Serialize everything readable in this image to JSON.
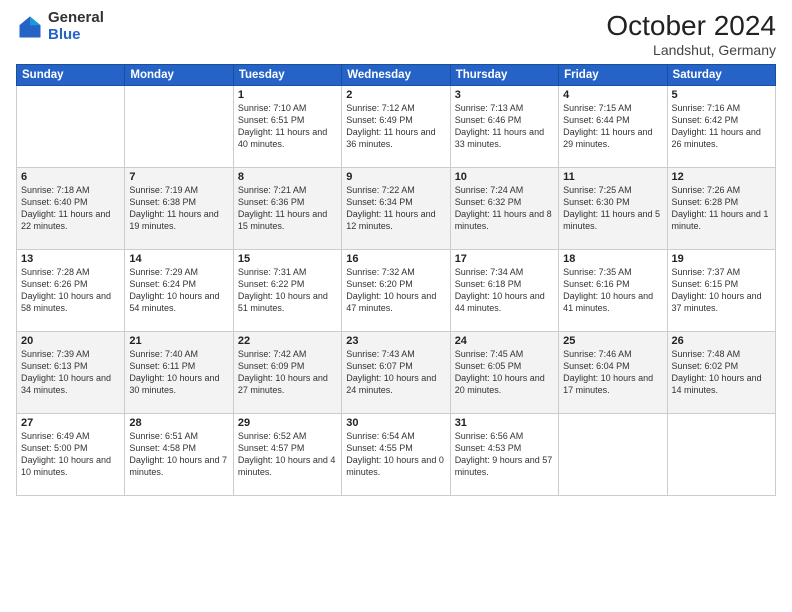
{
  "header": {
    "logo_general": "General",
    "logo_blue": "Blue",
    "month_title": "October 2024",
    "location": "Landshut, Germany"
  },
  "weekdays": [
    "Sunday",
    "Monday",
    "Tuesday",
    "Wednesday",
    "Thursday",
    "Friday",
    "Saturday"
  ],
  "weeks": [
    [
      {
        "day": "",
        "sunrise": "",
        "sunset": "",
        "daylight": ""
      },
      {
        "day": "",
        "sunrise": "",
        "sunset": "",
        "daylight": ""
      },
      {
        "day": "1",
        "sunrise": "Sunrise: 7:10 AM",
        "sunset": "Sunset: 6:51 PM",
        "daylight": "Daylight: 11 hours and 40 minutes."
      },
      {
        "day": "2",
        "sunrise": "Sunrise: 7:12 AM",
        "sunset": "Sunset: 6:49 PM",
        "daylight": "Daylight: 11 hours and 36 minutes."
      },
      {
        "day": "3",
        "sunrise": "Sunrise: 7:13 AM",
        "sunset": "Sunset: 6:46 PM",
        "daylight": "Daylight: 11 hours and 33 minutes."
      },
      {
        "day": "4",
        "sunrise": "Sunrise: 7:15 AM",
        "sunset": "Sunset: 6:44 PM",
        "daylight": "Daylight: 11 hours and 29 minutes."
      },
      {
        "day": "5",
        "sunrise": "Sunrise: 7:16 AM",
        "sunset": "Sunset: 6:42 PM",
        "daylight": "Daylight: 11 hours and 26 minutes."
      }
    ],
    [
      {
        "day": "6",
        "sunrise": "Sunrise: 7:18 AM",
        "sunset": "Sunset: 6:40 PM",
        "daylight": "Daylight: 11 hours and 22 minutes."
      },
      {
        "day": "7",
        "sunrise": "Sunrise: 7:19 AM",
        "sunset": "Sunset: 6:38 PM",
        "daylight": "Daylight: 11 hours and 19 minutes."
      },
      {
        "day": "8",
        "sunrise": "Sunrise: 7:21 AM",
        "sunset": "Sunset: 6:36 PM",
        "daylight": "Daylight: 11 hours and 15 minutes."
      },
      {
        "day": "9",
        "sunrise": "Sunrise: 7:22 AM",
        "sunset": "Sunset: 6:34 PM",
        "daylight": "Daylight: 11 hours and 12 minutes."
      },
      {
        "day": "10",
        "sunrise": "Sunrise: 7:24 AM",
        "sunset": "Sunset: 6:32 PM",
        "daylight": "Daylight: 11 hours and 8 minutes."
      },
      {
        "day": "11",
        "sunrise": "Sunrise: 7:25 AM",
        "sunset": "Sunset: 6:30 PM",
        "daylight": "Daylight: 11 hours and 5 minutes."
      },
      {
        "day": "12",
        "sunrise": "Sunrise: 7:26 AM",
        "sunset": "Sunset: 6:28 PM",
        "daylight": "Daylight: 11 hours and 1 minute."
      }
    ],
    [
      {
        "day": "13",
        "sunrise": "Sunrise: 7:28 AM",
        "sunset": "Sunset: 6:26 PM",
        "daylight": "Daylight: 10 hours and 58 minutes."
      },
      {
        "day": "14",
        "sunrise": "Sunrise: 7:29 AM",
        "sunset": "Sunset: 6:24 PM",
        "daylight": "Daylight: 10 hours and 54 minutes."
      },
      {
        "day": "15",
        "sunrise": "Sunrise: 7:31 AM",
        "sunset": "Sunset: 6:22 PM",
        "daylight": "Daylight: 10 hours and 51 minutes."
      },
      {
        "day": "16",
        "sunrise": "Sunrise: 7:32 AM",
        "sunset": "Sunset: 6:20 PM",
        "daylight": "Daylight: 10 hours and 47 minutes."
      },
      {
        "day": "17",
        "sunrise": "Sunrise: 7:34 AM",
        "sunset": "Sunset: 6:18 PM",
        "daylight": "Daylight: 10 hours and 44 minutes."
      },
      {
        "day": "18",
        "sunrise": "Sunrise: 7:35 AM",
        "sunset": "Sunset: 6:16 PM",
        "daylight": "Daylight: 10 hours and 41 minutes."
      },
      {
        "day": "19",
        "sunrise": "Sunrise: 7:37 AM",
        "sunset": "Sunset: 6:15 PM",
        "daylight": "Daylight: 10 hours and 37 minutes."
      }
    ],
    [
      {
        "day": "20",
        "sunrise": "Sunrise: 7:39 AM",
        "sunset": "Sunset: 6:13 PM",
        "daylight": "Daylight: 10 hours and 34 minutes."
      },
      {
        "day": "21",
        "sunrise": "Sunrise: 7:40 AM",
        "sunset": "Sunset: 6:11 PM",
        "daylight": "Daylight: 10 hours and 30 minutes."
      },
      {
        "day": "22",
        "sunrise": "Sunrise: 7:42 AM",
        "sunset": "Sunset: 6:09 PM",
        "daylight": "Daylight: 10 hours and 27 minutes."
      },
      {
        "day": "23",
        "sunrise": "Sunrise: 7:43 AM",
        "sunset": "Sunset: 6:07 PM",
        "daylight": "Daylight: 10 hours and 24 minutes."
      },
      {
        "day": "24",
        "sunrise": "Sunrise: 7:45 AM",
        "sunset": "Sunset: 6:05 PM",
        "daylight": "Daylight: 10 hours and 20 minutes."
      },
      {
        "day": "25",
        "sunrise": "Sunrise: 7:46 AM",
        "sunset": "Sunset: 6:04 PM",
        "daylight": "Daylight: 10 hours and 17 minutes."
      },
      {
        "day": "26",
        "sunrise": "Sunrise: 7:48 AM",
        "sunset": "Sunset: 6:02 PM",
        "daylight": "Daylight: 10 hours and 14 minutes."
      }
    ],
    [
      {
        "day": "27",
        "sunrise": "Sunrise: 6:49 AM",
        "sunset": "Sunset: 5:00 PM",
        "daylight": "Daylight: 10 hours and 10 minutes."
      },
      {
        "day": "28",
        "sunrise": "Sunrise: 6:51 AM",
        "sunset": "Sunset: 4:58 PM",
        "daylight": "Daylight: 10 hours and 7 minutes."
      },
      {
        "day": "29",
        "sunrise": "Sunrise: 6:52 AM",
        "sunset": "Sunset: 4:57 PM",
        "daylight": "Daylight: 10 hours and 4 minutes."
      },
      {
        "day": "30",
        "sunrise": "Sunrise: 6:54 AM",
        "sunset": "Sunset: 4:55 PM",
        "daylight": "Daylight: 10 hours and 0 minutes."
      },
      {
        "day": "31",
        "sunrise": "Sunrise: 6:56 AM",
        "sunset": "Sunset: 4:53 PM",
        "daylight": "Daylight: 9 hours and 57 minutes."
      },
      {
        "day": "",
        "sunrise": "",
        "sunset": "",
        "daylight": ""
      },
      {
        "day": "",
        "sunrise": "",
        "sunset": "",
        "daylight": ""
      }
    ]
  ]
}
